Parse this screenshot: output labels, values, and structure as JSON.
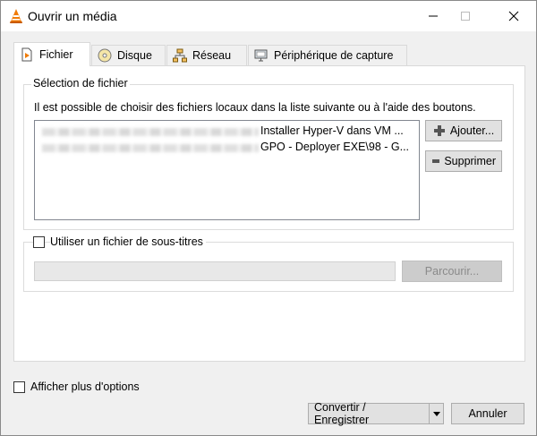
{
  "window": {
    "title": "Ouvrir un média",
    "minimize_glyph": "—",
    "maximize_glyph": "☐",
    "close_glyph": "✕"
  },
  "tabs": [
    {
      "label": "Fichier",
      "icon": "file-icon",
      "active": true
    },
    {
      "label": "Disque",
      "icon": "disc-icon",
      "active": false
    },
    {
      "label": "Réseau",
      "icon": "network-icon",
      "active": false
    },
    {
      "label": "Périphérique de capture",
      "icon": "capture-device-icon",
      "active": false
    }
  ],
  "file_section": {
    "title": "Sélection de fichier",
    "description": "Il est possible de choisir des fichiers locaux dans la liste suivante ou à l'aide des boutons.",
    "files": [
      {
        "visible_name": "Installer Hyper-V dans VM ..."
      },
      {
        "visible_name": "GPO - Deployer EXE\\98 - G..."
      }
    ],
    "add_button": "Ajouter...",
    "remove_button": "Supprimer"
  },
  "subtitle_section": {
    "checkbox_label": "Utiliser un fichier de sous-titres",
    "checked": false,
    "path_value": "",
    "browse_button": "Parcourir..."
  },
  "footer": {
    "more_options_label": "Afficher plus d'options",
    "more_options_checked": false,
    "convert_button": "Convertir / Enregistrer",
    "cancel_button": "Annuler"
  },
  "colors": {
    "vlc_orange": "#f07b06",
    "window_bg": "#f0f0f0",
    "panel_bg": "#ffffff",
    "disabled_button": "#cccccc"
  }
}
